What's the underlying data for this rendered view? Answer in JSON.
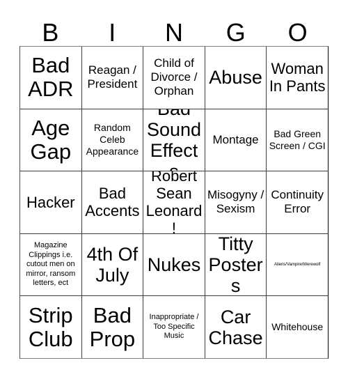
{
  "card": {
    "header_letters": [
      "B",
      "I",
      "N",
      "G",
      "O"
    ],
    "columns": 5,
    "rows": 5,
    "text_color": "#000000",
    "background_color": "#ffffff",
    "grid_line_color": "#3b3b3b"
  },
  "grid": [
    [
      {
        "label": "Bad ADR",
        "size": "fs-xxl"
      },
      {
        "label": "Reagan / President",
        "size": "fs-m"
      },
      {
        "label": "Child of Divorce / Orphan",
        "size": "fs-m"
      },
      {
        "label": "Abuse",
        "size": "fs-xl"
      },
      {
        "label": "Woman In Pants",
        "size": "fs-l"
      }
    ],
    [
      {
        "label": "Age Gap",
        "size": "fs-xxl"
      },
      {
        "label": "Random Celeb Appearance",
        "size": "fs-s"
      },
      {
        "label": "Bad Sound Effects",
        "size": "fs-xl"
      },
      {
        "label": "Montage",
        "size": "fs-m"
      },
      {
        "label": "Bad Green Screen / CGI",
        "size": "fs-s"
      }
    ],
    [
      {
        "label": "Hacker",
        "size": "fs-l"
      },
      {
        "label": "Bad Accents",
        "size": "fs-l"
      },
      {
        "label": "Robert Sean Leonard!",
        "size": "fs-l"
      },
      {
        "label": "Misogyny / Sexism",
        "size": "fs-m"
      },
      {
        "label": "Continuity Error",
        "size": "fs-m"
      }
    ],
    [
      {
        "label": "Magazine Clippings i.e. cutout men on mirror, ransom letters, ect",
        "size": "fs-xs"
      },
      {
        "label": "4th Of July",
        "size": "fs-xl"
      },
      {
        "label": "Nukes",
        "size": "fs-xl"
      },
      {
        "label": "Titty Posters",
        "size": "fs-xl"
      },
      {
        "label": "Aliens/Vampire/Werewolf",
        "size": "fs-xxs"
      }
    ],
    [
      {
        "label": "Strip Club",
        "size": "fs-xxl"
      },
      {
        "label": "Bad Prop",
        "size": "fs-xxl"
      },
      {
        "label": "Inappropriate / Too Specific Music",
        "size": "fs-xs"
      },
      {
        "label": "Car Chase",
        "size": "fs-xl"
      },
      {
        "label": "Whitehouse",
        "size": "fs-s"
      }
    ]
  ]
}
